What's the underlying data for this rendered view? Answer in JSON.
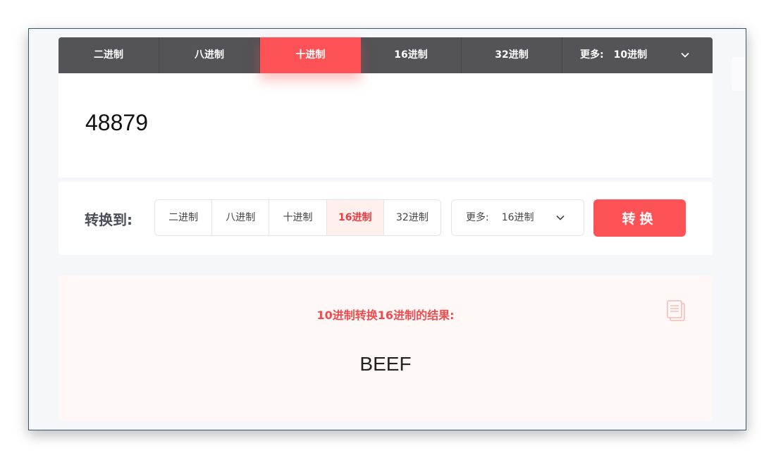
{
  "tabs": [
    {
      "label": "二进制",
      "active": false
    },
    {
      "label": "八进制",
      "active": false
    },
    {
      "label": "十进制",
      "active": true
    },
    {
      "label": "16进制",
      "active": false
    },
    {
      "label": "32进制",
      "active": false
    }
  ],
  "tab_more": {
    "label": "更多:",
    "value": "10进制",
    "icon": "chevron-down-icon"
  },
  "input": {
    "value": "48879"
  },
  "convert": {
    "label": "转换到:",
    "options": [
      {
        "label": "二进制",
        "active": false
      },
      {
        "label": "八进制",
        "active": false
      },
      {
        "label": "十进制",
        "active": false
      },
      {
        "label": "16进制",
        "active": true
      },
      {
        "label": "32进制",
        "active": false
      }
    ],
    "more": {
      "label": "更多:",
      "value": "16进制"
    },
    "button_label": "转换"
  },
  "result": {
    "title": "10进制转换16进制的结果:",
    "value": "BEEF",
    "copy_icon": "copy-icon"
  },
  "colors": {
    "accent": "#fd5356",
    "tabbar": "#545357",
    "result_bg": "#fff8f6"
  }
}
